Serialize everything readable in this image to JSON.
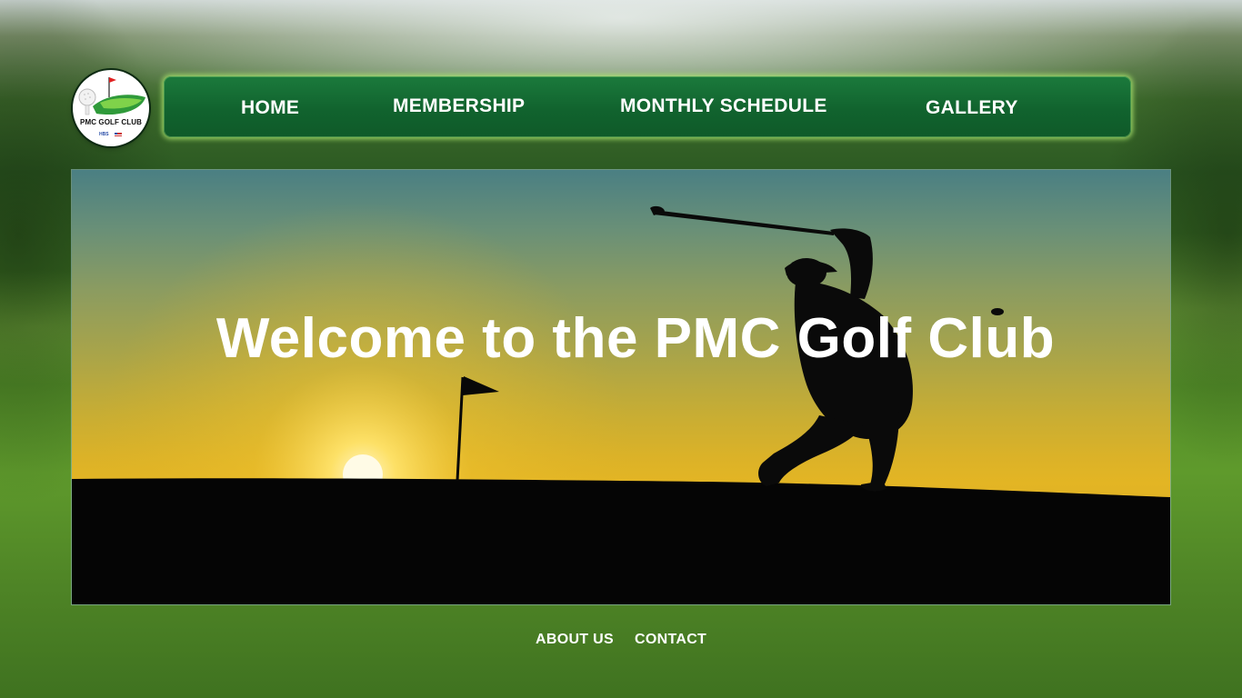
{
  "logo": {
    "text": "PMC GOLF CLUB",
    "small_text": "HBS"
  },
  "nav": {
    "items": [
      {
        "label": "HOME"
      },
      {
        "label": "MEMBERSHIP"
      },
      {
        "label": "MONTHLY SCHEDULE"
      },
      {
        "label": "GALLERY"
      }
    ]
  },
  "hero": {
    "title": "Welcome to the PMC Golf Club"
  },
  "footer": {
    "about_label": "ABOUT US",
    "contact_label": "CONTACT"
  },
  "colors": {
    "nav_green": "#11632e",
    "nav_glow": "#aae66e",
    "sky_top": "#4a7f83",
    "sky_sunset": "#e3b524",
    "text": "#ffffff"
  }
}
